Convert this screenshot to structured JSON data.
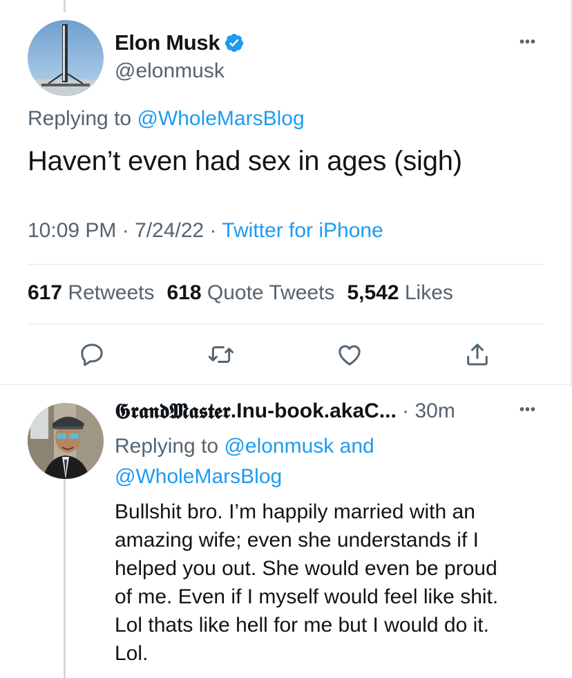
{
  "tweet": {
    "display_name": "Elon Musk",
    "handle": "@elonmusk",
    "replying_prefix": "Replying to",
    "replying_to": "@WholeMarsBlog",
    "text": "Haven’t even had sex in ages (sigh)",
    "time": "10:09 PM",
    "date": "7/24/22",
    "source": "Twitter for iPhone",
    "separator": "·"
  },
  "stats": {
    "retweets_count": "617",
    "retweets_label": "Retweets",
    "quotes_count": "618",
    "quotes_label": "Quote Tweets",
    "likes_count": "5,542",
    "likes_label": "Likes"
  },
  "actions": {
    "icons": [
      "reply-icon",
      "retweet-icon",
      "like-icon",
      "share-icon"
    ]
  },
  "reply": {
    "display_name_styled": "𝕲𝖗𝖆𝖓𝖉𝕸𝖆𝖘𝖙𝖊𝖗",
    "display_name_rest": ".Inu-book.akaC...",
    "separator": " · ",
    "time": "30m",
    "replying_prefix": "Replying to",
    "replying_to_1": "@elonmusk",
    "replying_and": "and",
    "replying_to_2": "@WholeMarsBlog",
    "text_lines": [
      "Bullshit bro. I’m happily married with an",
      "amazing wife; even she understands if I",
      "helped you out. She would even be proud",
      "of me. Even if I myself would feel like shit.",
      "Lol thats like hell for me but I would do it.",
      "Lol."
    ]
  },
  "colors": {
    "link": "#1d9bf0",
    "secondary_text": "#536471",
    "verified": "#1d9bf0"
  }
}
